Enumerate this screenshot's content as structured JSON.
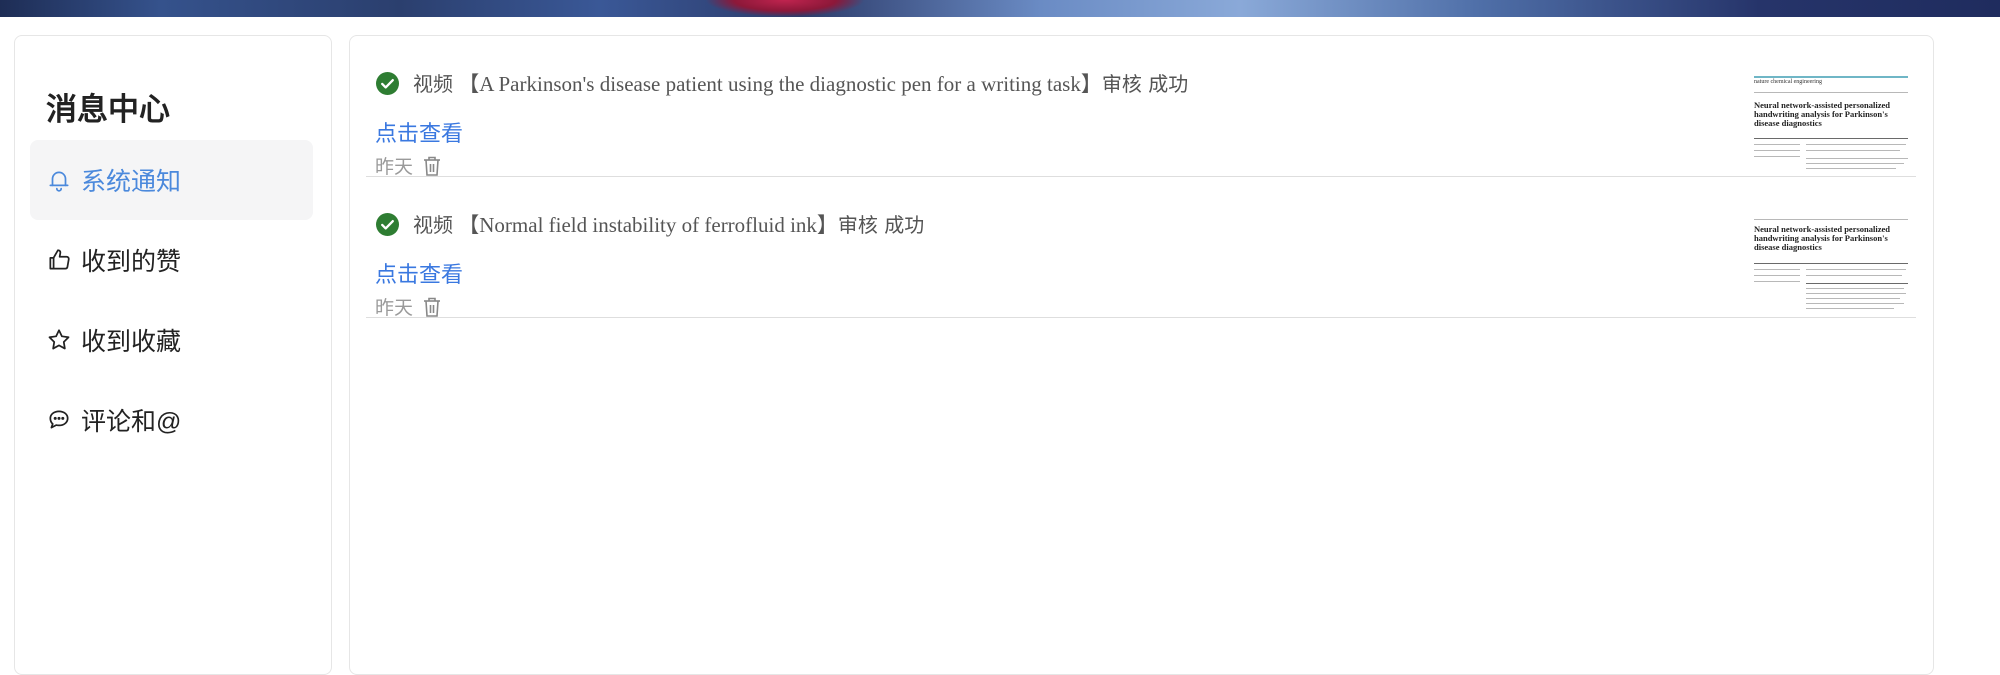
{
  "sidebar": {
    "title": "消息中心",
    "items": [
      {
        "label": "系统通知",
        "icon": "bell-icon",
        "active": true
      },
      {
        "label": "收到的赞",
        "icon": "thumbs-up-icon",
        "active": false
      },
      {
        "label": "收到收藏",
        "icon": "star-icon",
        "active": false
      },
      {
        "label": "评论和@",
        "icon": "comment-icon",
        "active": false
      }
    ]
  },
  "messages": [
    {
      "prefix": "视频",
      "title": "【A Parkinson's disease patient using the diagnostic pen for a writing task】",
      "status": "审核 成功",
      "link": "点击查看",
      "time": "昨天",
      "thumbnail": {
        "journal": "nature chemical engineering",
        "title": "Neural network-assisted personalized handwriting analysis for Parkinson's disease diagnostics"
      }
    },
    {
      "prefix": "视频",
      "title": "【Normal field instability of ferrofluid ink】",
      "status": "审核 成功",
      "link": "点击查看",
      "time": "昨天",
      "thumbnail": {
        "journal": "",
        "title": "Neural network-assisted personalized handwriting analysis for Parkinson's disease diagnostics"
      }
    }
  ],
  "colors": {
    "accent": "#4b89dc",
    "link": "#3a78e0",
    "success": "#2e7d32",
    "muted": "#9a9a9a"
  }
}
